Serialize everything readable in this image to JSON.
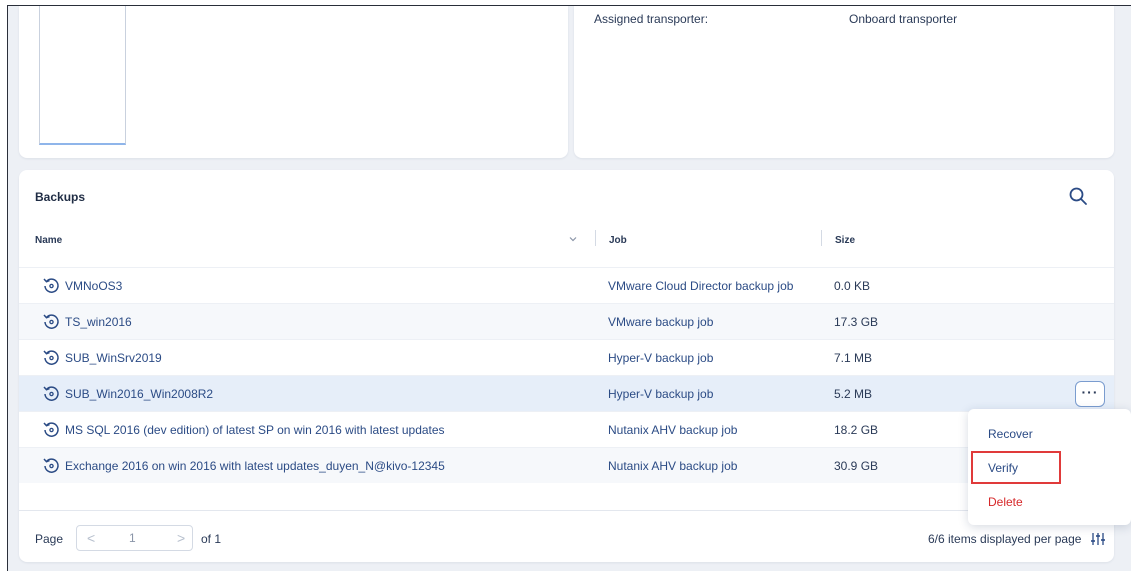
{
  "transporter": {
    "label": "Assigned transporter:",
    "value": "Onboard transporter"
  },
  "backups": {
    "title": "Backups",
    "search_icon": "search-icon",
    "columns": {
      "name": "Name",
      "job": "Job",
      "size": "Size"
    },
    "rows": [
      {
        "name": "VMNoOS3",
        "job": "VMware Cloud Director backup job",
        "size": "0.0 KB"
      },
      {
        "name": "TS_win2016",
        "job": "VMware backup job",
        "size": "17.3 GB"
      },
      {
        "name": "SUB_WinSrv2019",
        "job": "Hyper-V backup job",
        "size": "7.1 MB"
      },
      {
        "name": "SUB_Win2016_Win2008R2",
        "job": "Hyper-V backup job",
        "size": "5.2 MB"
      },
      {
        "name": "MS SQL 2016 (dev edition) of latest SP on win 2016 with latest updates",
        "job": "Nutanix AHV backup job",
        "size": "18.2 GB"
      },
      {
        "name": "Exchange 2016 on win 2016 with latest updates_duyen_N@kivo-12345",
        "job": "Nutanix AHV backup job",
        "size": "30.9 GB"
      }
    ],
    "more_button": "···"
  },
  "context_menu": {
    "items": [
      "Recover",
      "Verify",
      "Delete"
    ]
  },
  "pagination": {
    "page_label": "Page",
    "prev": "<",
    "current": "1",
    "next": ">",
    "of_label": "of 1",
    "items_label": "6/6 items displayed per page"
  },
  "colors": {
    "accent": "#2b4b85",
    "danger": "#d6282a",
    "highlight_box": "#e03a3a",
    "selected_row": "#e6eef9"
  }
}
